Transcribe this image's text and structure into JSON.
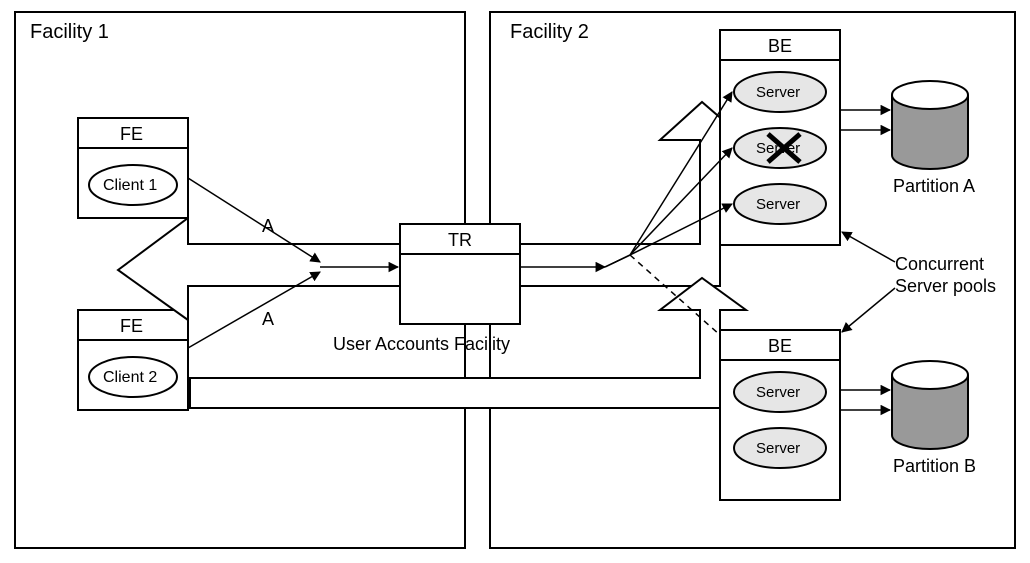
{
  "facility1": {
    "title": "Facility 1"
  },
  "facility2": {
    "title": "Facility 2"
  },
  "fe1": {
    "title": "FE",
    "client": "Client 1"
  },
  "fe2": {
    "title": "FE",
    "client": "Client 2"
  },
  "tr": {
    "title": "TR",
    "subtitle": "User Accounts Facility"
  },
  "be1": {
    "title": "BE",
    "server1": "Server",
    "server2": "Server",
    "server3": "Server"
  },
  "be2": {
    "title": "BE",
    "server1": "Server",
    "server2": "Server"
  },
  "partitionA": "Partition A",
  "partitionB": "Partition B",
  "concurrent": "Concurrent\nServer pools",
  "edgeA1": "A",
  "edgeA2": "A"
}
